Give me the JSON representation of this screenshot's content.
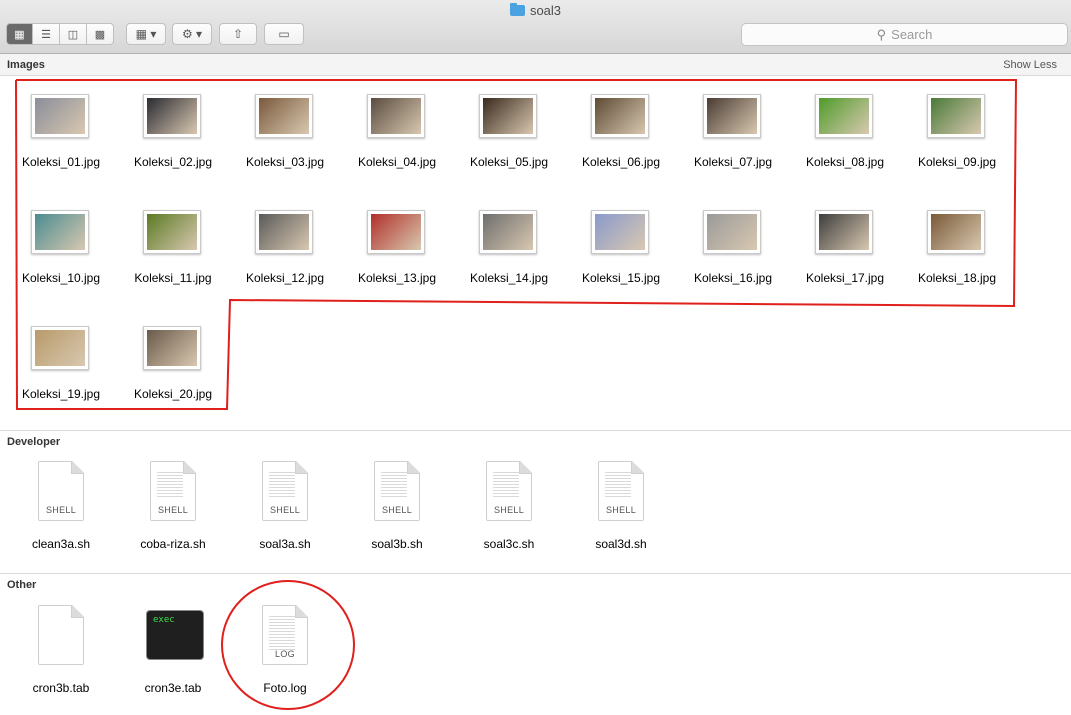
{
  "window": {
    "title": "soal3"
  },
  "toolbar": {
    "view_buttons": [
      "icon-view",
      "list-view",
      "column-view",
      "cover-flow-view"
    ],
    "arrange_icon": "arrange-icon",
    "action_icon": "gear-icon",
    "share_icon": "share-icon",
    "tag_icon": "tag-icon",
    "search_placeholder": "Search"
  },
  "sections": {
    "images": {
      "title": "Images",
      "toggle": "Show Less",
      "items": [
        {
          "name": "Koleksi_01.jpg",
          "color": "#8a8d9a"
        },
        {
          "name": "Koleksi_02.jpg",
          "color": "#2b2b33"
        },
        {
          "name": "Koleksi_03.jpg",
          "color": "#7a5a3c"
        },
        {
          "name": "Koleksi_04.jpg",
          "color": "#5a4c40"
        },
        {
          "name": "Koleksi_05.jpg",
          "color": "#3a2a1e"
        },
        {
          "name": "Koleksi_06.jpg",
          "color": "#5e4a35"
        },
        {
          "name": "Koleksi_07.jpg",
          "color": "#4a3c34"
        },
        {
          "name": "Koleksi_08.jpg",
          "color": "#4f9c2a"
        },
        {
          "name": "Koleksi_09.jpg",
          "color": "#4a7a38"
        },
        {
          "name": "Koleksi_10.jpg",
          "color": "#4a8c90"
        },
        {
          "name": "Koleksi_11.jpg",
          "color": "#5b7a24"
        },
        {
          "name": "Koleksi_12.jpg",
          "color": "#5a5a5a"
        },
        {
          "name": "Koleksi_13.jpg",
          "color": "#b0302a"
        },
        {
          "name": "Koleksi_14.jpg",
          "color": "#6e6e6e"
        },
        {
          "name": "Koleksi_15.jpg",
          "color": "#8a9acc"
        },
        {
          "name": "Koleksi_16.jpg",
          "color": "#9a9a9a"
        },
        {
          "name": "Koleksi_17.jpg",
          "color": "#3e3e3e"
        },
        {
          "name": "Koleksi_18.jpg",
          "color": "#7a5a38"
        },
        {
          "name": "Koleksi_19.jpg",
          "color": "#b89a6a"
        },
        {
          "name": "Koleksi_20.jpg",
          "color": "#6a5a4a"
        }
      ]
    },
    "developer": {
      "title": "Developer",
      "items": [
        {
          "name": "clean3a.sh",
          "tag": "SHELL"
        },
        {
          "name": "coba-riza.sh",
          "tag": "SHELL"
        },
        {
          "name": "soal3a.sh",
          "tag": "SHELL"
        },
        {
          "name": "soal3b.sh",
          "tag": "SHELL"
        },
        {
          "name": "soal3c.sh",
          "tag": "SHELL"
        },
        {
          "name": "soal3d.sh",
          "tag": "SHELL"
        }
      ]
    },
    "other": {
      "title": "Other",
      "items": [
        {
          "name": "cron3b.tab",
          "kind": "blank"
        },
        {
          "name": "cron3e.tab",
          "kind": "exec",
          "badge": "exec"
        },
        {
          "name": "Foto.log",
          "kind": "log",
          "tag": "LOG"
        }
      ]
    }
  },
  "annotation_colors": {
    "outline": "#e0201c"
  }
}
